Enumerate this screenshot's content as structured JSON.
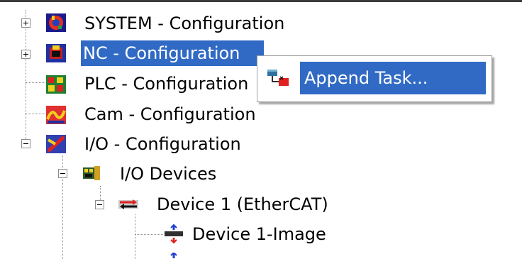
{
  "tree": {
    "items": [
      {
        "label": "SYSTEM - Configuration",
        "expander": "+",
        "icon": "system-config-icon"
      },
      {
        "label": "NC - Configuration",
        "expander": "+",
        "icon": "nc-config-icon",
        "selected": true
      },
      {
        "label": "PLC - Configuration",
        "icon": "plc-config-icon"
      },
      {
        "label": "Cam - Configuration",
        "icon": "cam-config-icon"
      },
      {
        "label": "I/O - Configuration",
        "expander": "-",
        "icon": "io-config-icon"
      },
      {
        "label": "I/O Devices",
        "expander": "-",
        "icon": "io-devices-icon"
      },
      {
        "label": "Device 1 (EtherCAT)",
        "expander": "-",
        "icon": "ethercat-device-icon"
      },
      {
        "label": "Device 1-Image",
        "icon": "device-image-icon"
      }
    ]
  },
  "context_menu": {
    "items": [
      {
        "label": "Append Task...",
        "icon": "append-task-icon",
        "highlighted": true
      }
    ]
  },
  "colors": {
    "selection": "#316ac5",
    "selection_text": "#ffffff"
  }
}
